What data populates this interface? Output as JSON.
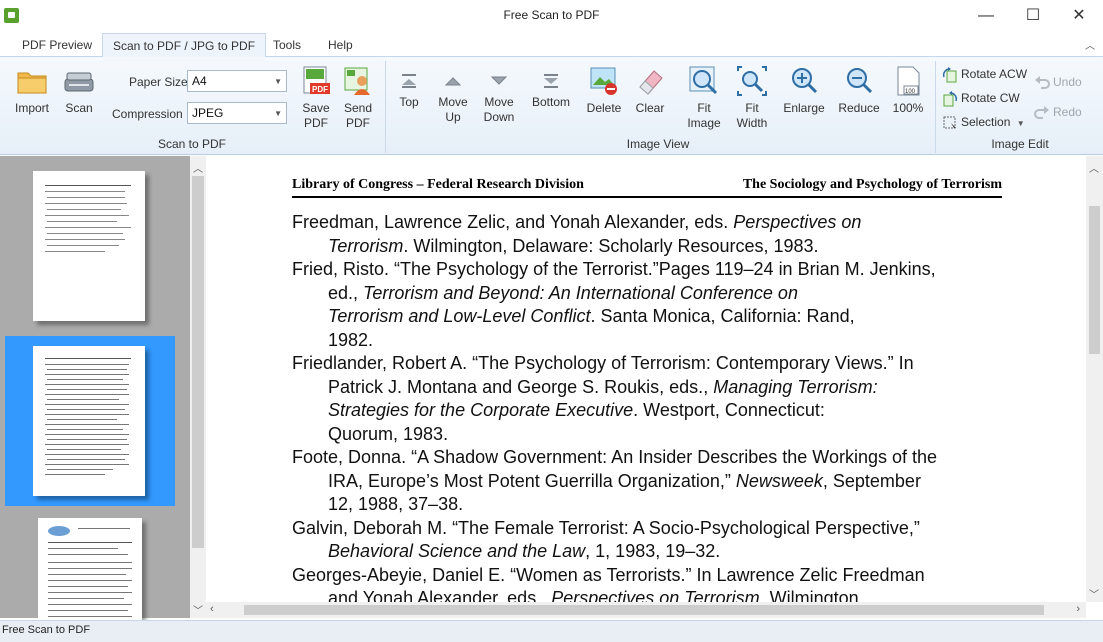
{
  "window": {
    "title": "Free Scan to PDF",
    "minimize": "—",
    "maximize": "☐",
    "close": "✕"
  },
  "tabs": [
    "PDF Preview",
    "Scan to PDF / JPG to PDF",
    "Tools",
    "Help"
  ],
  "active_tab": "Scan to PDF / JPG to PDF",
  "ribbon": {
    "import": "Import",
    "scan": "Scan",
    "paper_size_label": "Paper Size",
    "paper_size_value": "A4",
    "compression_label": "Compression",
    "compression_value": "JPEG",
    "save_pdf": [
      "Save",
      "PDF"
    ],
    "send_pdf": [
      "Send",
      "PDF"
    ],
    "group_scan": "Scan to PDF",
    "top": "Top",
    "move_up": [
      "Move",
      "Up"
    ],
    "move_down": [
      "Move",
      "Down"
    ],
    "bottom": "Bottom",
    "delete": "Delete",
    "clear": "Clear",
    "fit_image": [
      "Fit",
      "Image"
    ],
    "fit_width": [
      "Fit",
      "Width"
    ],
    "enlarge": "Enlarge",
    "reduce": "Reduce",
    "zoom_100": "100%",
    "group_view": "Image View",
    "rotate_acw": "Rotate ACW",
    "rotate_cw": "Rotate CW",
    "selection": "Selection",
    "undo": "Undo",
    "redo": "Redo",
    "group_edit": "Image Edit"
  },
  "document": {
    "header_left": "Library of Congress – Federal Research Division",
    "header_right": "The Sociology and Psychology of Terrorism",
    "entries": [
      {
        "lines": [
          [
            "Freedman, Lawrence Zelic, and Yonah Alexander, eds. ",
            {
              "i": "Perspectives on"
            }
          ],
          [
            {
              "i": "Terrorism"
            },
            ". Wilmington, Delaware: Scholarly Resources, 1983."
          ]
        ]
      },
      {
        "lines": [
          [
            "Fried, Risto. “The Psychology of the Terrorist.”Pages 119–24 in Brian M. Jenkins,"
          ],
          [
            "ed., ",
            {
              "i": "Terrorism and Beyond: An International Conference on"
            }
          ],
          [
            {
              "i": "Terrorism and Low-Level Conflict"
            },
            ". Santa Monica, California: Rand,"
          ],
          [
            "1982."
          ]
        ]
      },
      {
        "lines": [
          [
            "Friedlander, Robert A. “The Psychology of Terrorism: Contemporary Views.” In"
          ],
          [
            "Patrick J. Montana and George S. Roukis, eds., ",
            {
              "i": "Managing Terrorism:"
            }
          ],
          [
            {
              "i": "Strategies for the Corporate Executive"
            },
            ". Westport, Connecticut:"
          ],
          [
            "Quorum, 1983."
          ]
        ]
      },
      {
        "lines": [
          [
            "Foote, Donna. “A Shadow Government: An Insider Describes the Workings of the"
          ],
          [
            "IRA, Europe’s Most Potent Guerrilla Organization,” ",
            {
              "i": "Newsweek"
            },
            ", September"
          ],
          [
            "12, 1988, 37–38."
          ]
        ]
      },
      {
        "lines": [
          [
            "Galvin, Deborah M. “The Female Terrorist: A Socio-Psychological Perspective,”"
          ],
          [
            {
              "i": "Behavioral Science and the Law"
            },
            ", 1, 1983, 19–32."
          ]
        ]
      },
      {
        "lines": [
          [
            "Georges-Abeyie, Daniel E. “Women as Terrorists.” In Lawrence Zelic Freedman"
          ],
          [
            "and Yonah Alexander, eds., ",
            {
              "i": "Perspectives on Terrorism"
            },
            ". Wilmington,"
          ]
        ]
      }
    ]
  },
  "statusbar": {
    "text": "Free Scan to PDF"
  }
}
